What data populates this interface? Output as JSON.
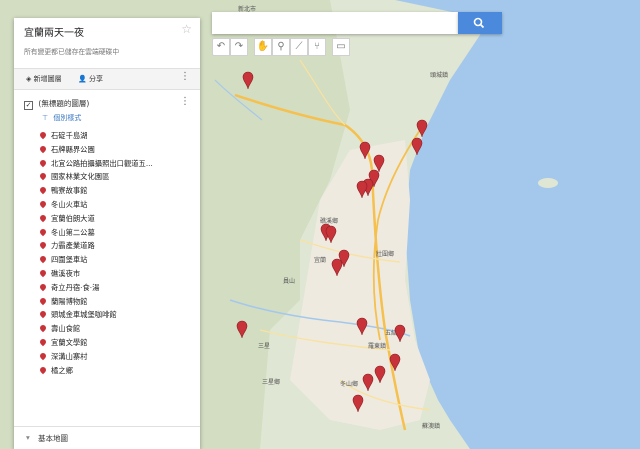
{
  "panel": {
    "title": "宜蘭兩天一夜",
    "subtitle": "所有變更都已儲存在雲端硬碟中",
    "add_layer_label": "新增圖層",
    "share_label": "分享",
    "layer_name": "(無標題的圖層)",
    "style_label": "個別樣式",
    "basemap_label": "基本地圖",
    "places": [
      "石碇千島湖",
      "石牌縣界公園",
      "北宜公路拍攝攝照出口觀道五...",
      "國家林業文化園區",
      "鴨寮故事館",
      "冬山火車站",
      "宜蘭伯朗大道",
      "冬山第二公墓",
      "力霸產業道路",
      "四圍堡車站",
      "礁溪夜市",
      "奇立丹宿·食·湯",
      "蘭陽博物館",
      "頭城金車城堡咖啡館",
      "壽山食館",
      "宜蘭文學館",
      "深溝山寨村",
      "橘之鄉"
    ]
  },
  "map_labels": {
    "county": "宜蘭",
    "wuwei": "五結",
    "sanxing": "三星鄉",
    "yuanshan": "員山",
    "dongshan": "冬山鄉",
    "zhuangwei": "壯圍鄉",
    "suao": "蘇澳鎮",
    "toucheng": "頭城鎮",
    "luodong": "羅東鎮",
    "sanxing2": "三星",
    "jiaoxi": "礁溪鄉",
    "taipei_north": "新北市"
  },
  "colors": {
    "water": "#a4c8ec",
    "land": "#dfe6d3",
    "urban": "#eeeae0",
    "road_major": "#f5c04d",
    "pin": "#c8333a",
    "accent": "#4a89dc"
  }
}
